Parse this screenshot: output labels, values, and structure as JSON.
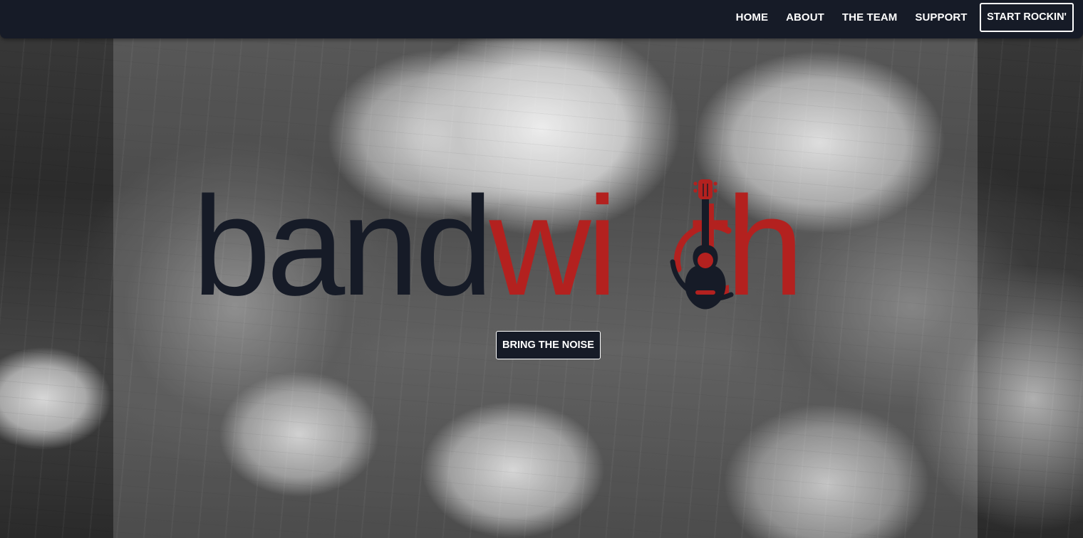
{
  "nav": {
    "links": [
      {
        "label": "HOME"
      },
      {
        "label": "ABOUT"
      },
      {
        "label": "THE TEAM"
      },
      {
        "label": "SUPPORT"
      }
    ],
    "cta_label": "START ROCKIN'"
  },
  "hero": {
    "logo": {
      "part_dark": "band",
      "part_red": "wi",
      "part_red_end": "th",
      "icon": "guitar-icon"
    },
    "cta_label": "BRING THE NOISE",
    "background_image": "black-and-white live band concert photo"
  },
  "colors": {
    "navbar": "#161b27",
    "brand_dark": "#161b27",
    "brand_red": "#b3211f",
    "button_text": "#ffffff"
  }
}
